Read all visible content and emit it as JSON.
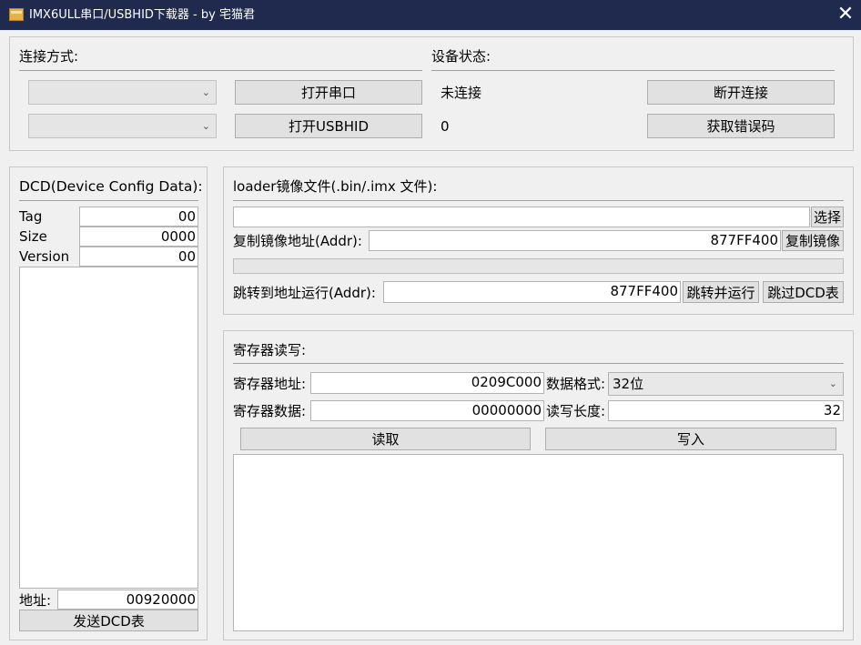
{
  "window": {
    "title": "IMX6ULL串口/USBHID下载器 - by 宅猫君",
    "close_glyph": "✕"
  },
  "connection": {
    "section_label": "连接方式:",
    "serial_button": "打开串口",
    "usbhid_button": "打开USBHID",
    "serial_select_value": "",
    "usbhid_select_value": ""
  },
  "device": {
    "section_label": "设备状态:",
    "status": "未连接",
    "error_code": "0",
    "disconnect_button": "断开连接",
    "get_error_button": "获取错误码"
  },
  "dcd": {
    "section_label": "DCD(Device Config Data):",
    "tag_label": "Tag",
    "tag_value": "00",
    "size_label": "Size",
    "size_value": "0000",
    "version_label": "Version",
    "version_value": "00",
    "address_label": "地址:",
    "address_value": "00920000",
    "send_button": "发送DCD表"
  },
  "loader": {
    "section_label": "loader镜像文件(.bin/.imx 文件):",
    "file_path": "",
    "choose_button": "选择",
    "copy_addr_label": "复制镜像地址(Addr):",
    "copy_addr_value": "877FF400",
    "copy_button": "复制镜像",
    "progress": 0,
    "jump_addr_label": "跳转到地址运行(Addr):",
    "jump_addr_value": "877FF400",
    "jump_button": "跳转并运行",
    "skip_dcd_button": "跳过DCD表"
  },
  "register": {
    "section_label": "寄存器读写:",
    "addr_label": "寄存器地址:",
    "addr_value": "0209C000",
    "format_label": "数据格式:",
    "format_value": "32位",
    "data_label": "寄存器数据:",
    "data_value": "00000000",
    "length_label": "读写长度:",
    "length_value": "32",
    "read_button": "读取",
    "write_button": "写入"
  },
  "icons": {
    "dropdown": "chevron-down-icon",
    "app": "folder-icon",
    "close": "close-icon"
  },
  "colors": {
    "titlebar": "#1f2a4e",
    "button_bg": "#e1e1e1",
    "window_bg": "#f0f0f0"
  }
}
